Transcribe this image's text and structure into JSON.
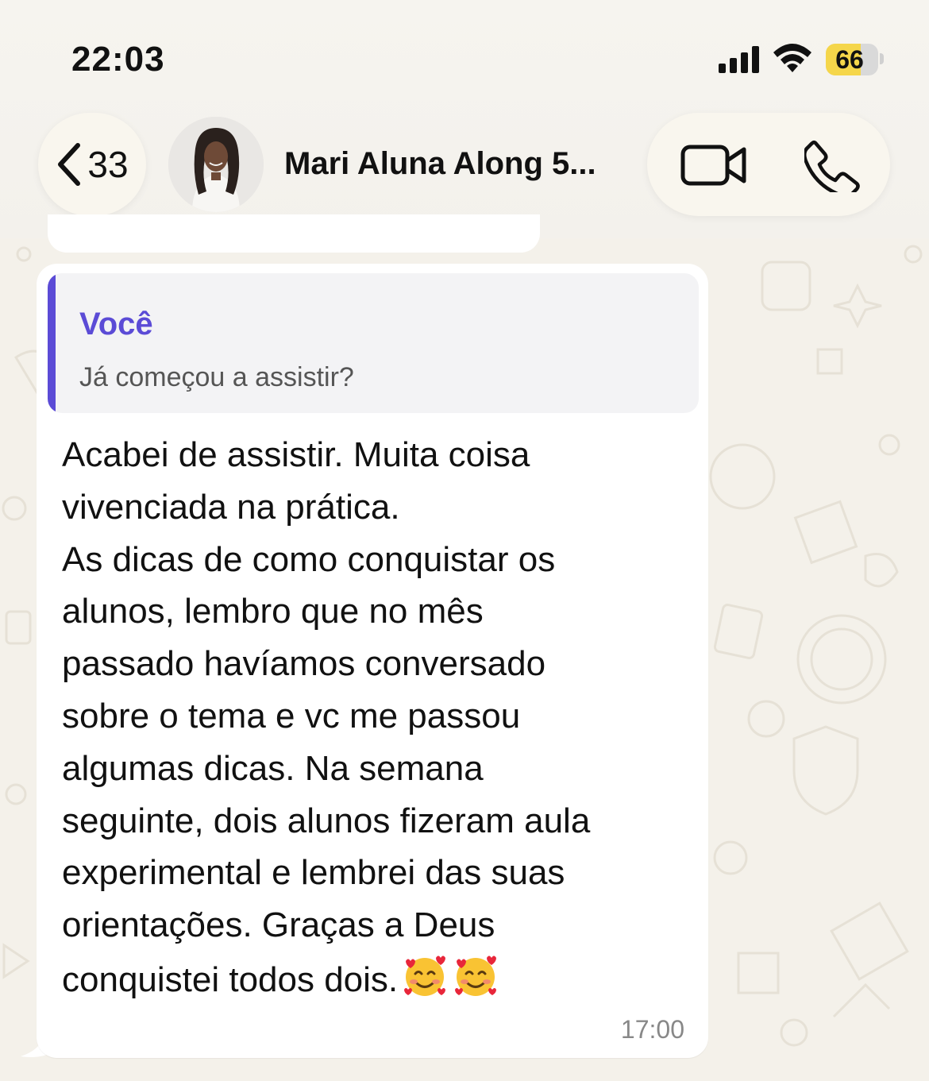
{
  "status_bar": {
    "time": "22:03",
    "battery": "66"
  },
  "header": {
    "back_count": "33",
    "contact_name": "Mari Aluna Along 5..."
  },
  "message": {
    "quoted_author": "Você",
    "quoted_text": "Já começou a assistir?",
    "text": "Acabei de assistir. Muita coisa\nvivenciada na prática.\nAs dicas de como conquistar os\nalunos, lembro que no mês\npassado havíamos conversado\nsobre o tema e vc me passou\nalgumas dicas. Na semana\nseguinte, dois alunos fizeram aula\nexperimental e lembrei das suas\norientações. Graças a Deus\nconquistei todos dois.",
    "emoji_names": [
      "smiling-face-with-hearts-icon",
      "smiling-face-with-hearts-icon"
    ],
    "time": "17:00"
  },
  "colors": {
    "accent": "#5b4bd6",
    "battery": "#f5d64a",
    "wallpaper": "#f4f1ea"
  }
}
